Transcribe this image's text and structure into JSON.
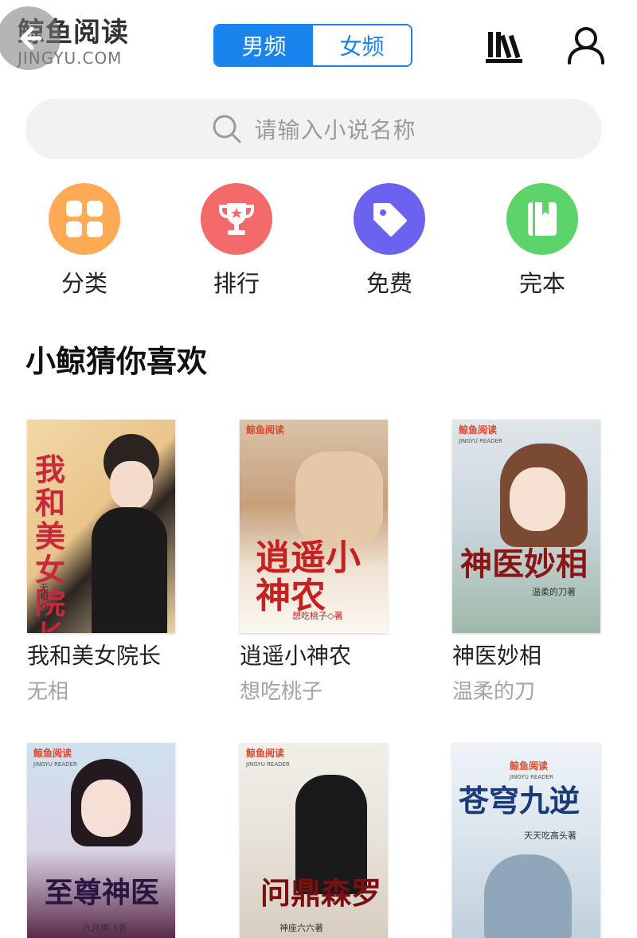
{
  "header": {
    "logo_cn": "鲸鱼阅读",
    "logo_en": "JINGYU.COM",
    "tabs": [
      {
        "label": "男频",
        "active": true
      },
      {
        "label": "女频",
        "active": false
      }
    ]
  },
  "search": {
    "placeholder": "请输入小说名称"
  },
  "quick_nav": [
    {
      "label": "分类",
      "icon": "grid-icon",
      "color": "#ffaa55"
    },
    {
      "label": "排行",
      "icon": "trophy-icon",
      "color": "#f46a6a"
    },
    {
      "label": "免费",
      "icon": "tag-icon",
      "color": "#6b63f0"
    },
    {
      "label": "完本",
      "icon": "book-icon",
      "color": "#5cd46a"
    }
  ],
  "section": {
    "title": "小鲸猜你喜欢"
  },
  "books": [
    {
      "title": "我和美女院长",
      "author": "无相",
      "cover_title": "我和美女院长",
      "cover_author": "无相◇著"
    },
    {
      "title": "逍遥小神农",
      "author": "想吃桃子",
      "cover_title": "逍遥小神农",
      "cover_author": "想吃桃子◇著"
    },
    {
      "title": "神医妙相",
      "author": "温柔的刀",
      "cover_title": "神医妙相",
      "cover_author": "温柔的刀著"
    },
    {
      "title": "",
      "author": "",
      "cover_title": "至尊神医",
      "cover_author": "九月鹰飞著"
    },
    {
      "title": "",
      "author": "",
      "cover_title": "问鼎森罗",
      "cover_author": "神座六六著"
    },
    {
      "title": "",
      "author": "",
      "cover_title": "苍穹九逆",
      "cover_author": "天天吃高头著"
    }
  ],
  "cover_brand": {
    "cn": "鲸鱼阅读",
    "en": "JINGYU READER"
  }
}
